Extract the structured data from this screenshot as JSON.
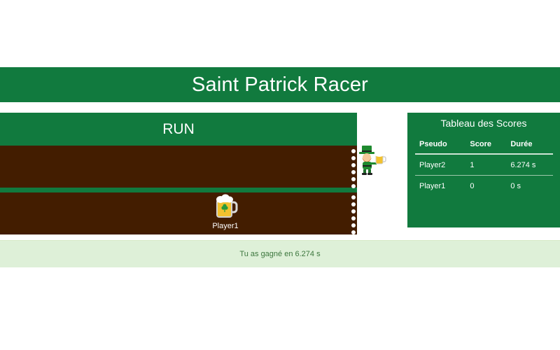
{
  "header": {
    "title": "Saint Patrick Racer"
  },
  "game": {
    "run_label": "RUN",
    "racers": [
      {
        "name": "Player1",
        "icon": "beer-mug-icon"
      }
    ],
    "winner_icon": "leprechaun-icon"
  },
  "scoreboard": {
    "title": "Tableau des Scores",
    "columns": [
      "Pseudo",
      "Score",
      "Durée"
    ],
    "rows": [
      [
        "Player2",
        "1",
        "6.274 s"
      ],
      [
        "Player1",
        "0",
        "0 s"
      ]
    ]
  },
  "result": {
    "message": "Tu as gagné en 6.274 s"
  },
  "colors": {
    "green": "#117a3e",
    "track": "#431d00",
    "alert_bg": "#def0d8",
    "alert_text": "#3c763d"
  }
}
